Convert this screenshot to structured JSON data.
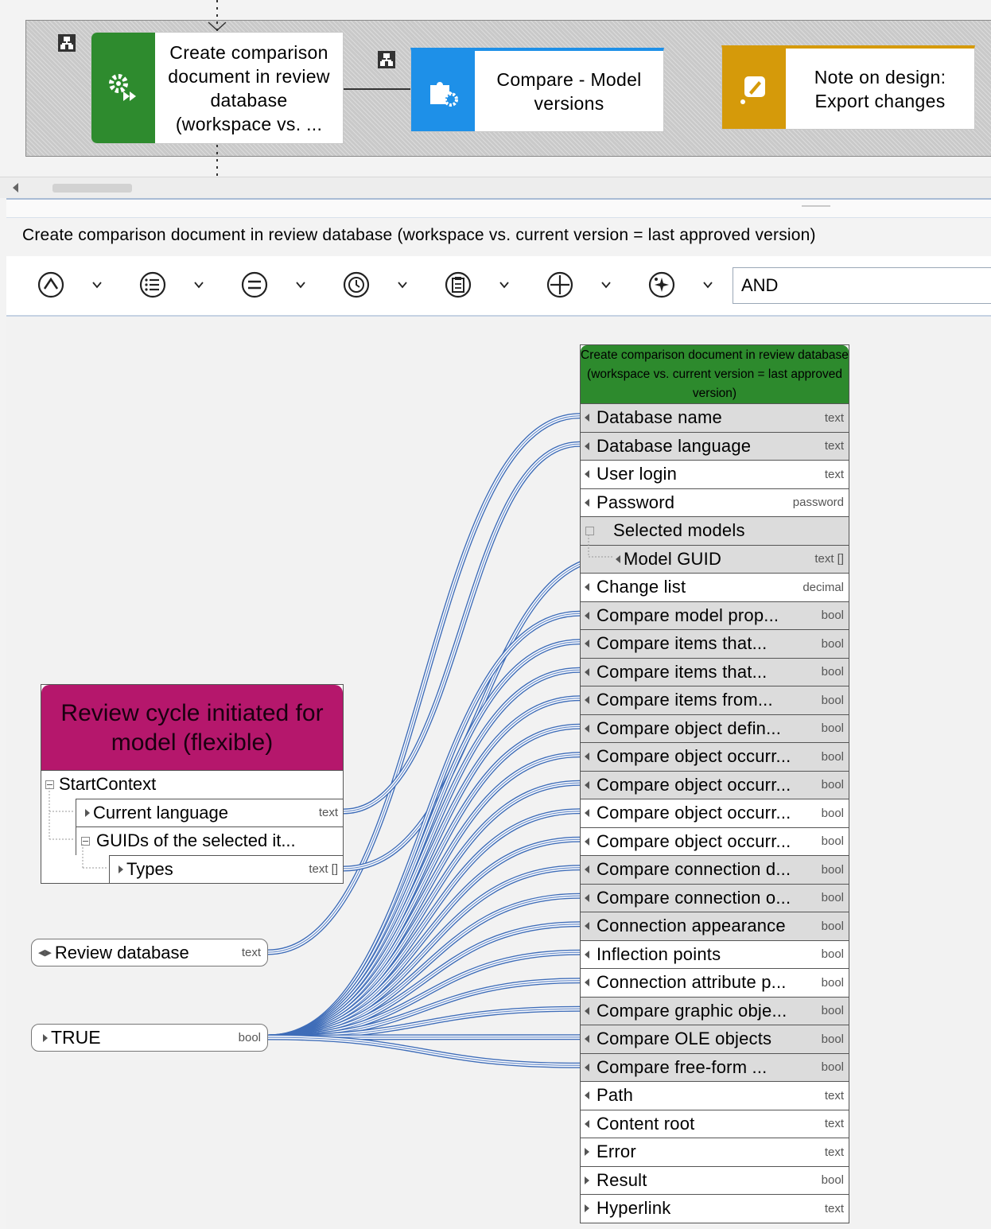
{
  "top_model": {
    "cards": [
      {
        "text": "Create comparison document in review database (workspace vs. ...",
        "icon": "gear-forward-icon",
        "color": "#2e8b2e"
      },
      {
        "text": "Compare - Model versions",
        "icon": "puzzle-gear-icon",
        "color": "#1e90e8"
      },
      {
        "text": "Note on design: Export changes",
        "icon": "edit-note-icon",
        "color": "#d59a0a"
      }
    ]
  },
  "details": {
    "title": "Create comparison document in review database (workspace vs. current version = last approved version)"
  },
  "toolbar": {
    "icons": [
      "circle-up-icon",
      "circle-list-icon",
      "circle-equals-icon",
      "circle-clock-icon",
      "circle-clipboard-icon",
      "circle-plus-icon",
      "circle-sparkle-icon"
    ],
    "operator": "AND"
  },
  "target": {
    "title": "Create comparison document in review database (workspace vs. current version = last approved version)",
    "rows": [
      {
        "label": "Database name",
        "type": "text",
        "gray": true
      },
      {
        "label": "Database language",
        "type": "text",
        "gray": true
      },
      {
        "label": "User login",
        "type": "text",
        "gray": false
      },
      {
        "label": "Password",
        "type": "password",
        "gray": false
      },
      {
        "label": "Selected models",
        "type": "",
        "gray": true
      },
      {
        "label": "Model GUID",
        "type": "text []",
        "gray": true
      },
      {
        "label": "Change list",
        "type": "decimal",
        "gray": false
      },
      {
        "label": "Compare model prop...",
        "type": "bool",
        "gray": true
      },
      {
        "label": "Compare items that...",
        "type": "bool",
        "gray": true
      },
      {
        "label": "Compare items that...",
        "type": "bool",
        "gray": true
      },
      {
        "label": "Compare items from...",
        "type": "bool",
        "gray": true
      },
      {
        "label": "Compare object defin...",
        "type": "bool",
        "gray": true
      },
      {
        "label": "Compare object occurr...",
        "type": "bool",
        "gray": true
      },
      {
        "label": "Compare object occurr...",
        "type": "bool",
        "gray": true
      },
      {
        "label": "Compare object occurr...",
        "type": "bool",
        "gray": false
      },
      {
        "label": "Compare object occurr...",
        "type": "bool",
        "gray": false
      },
      {
        "label": "Compare connection d...",
        "type": "bool",
        "gray": true
      },
      {
        "label": "Compare connection o...",
        "type": "bool",
        "gray": true
      },
      {
        "label": "Connection appearance",
        "type": "bool",
        "gray": true
      },
      {
        "label": "Inflection points",
        "type": "bool",
        "gray": false
      },
      {
        "label": "Connection attribute p...",
        "type": "bool",
        "gray": false
      },
      {
        "label": "Compare graphic obje...",
        "type": "bool",
        "gray": true
      },
      {
        "label": "Compare OLE objects",
        "type": "bool",
        "gray": true
      },
      {
        "label": "Compare free-form ...",
        "type": "bool",
        "gray": true
      },
      {
        "label": "Path",
        "type": "text",
        "gray": false
      },
      {
        "label": "Content root",
        "type": "text",
        "gray": false
      },
      {
        "label": "Error",
        "type": "text",
        "gray": false
      },
      {
        "label": "Result",
        "type": "bool",
        "gray": false
      },
      {
        "label": "Hyperlink",
        "type": "text",
        "gray": false
      }
    ]
  },
  "event": {
    "title": "Review cycle initiated for model (flexible)",
    "rows": [
      {
        "label": "StartContext",
        "type": ""
      },
      {
        "label": "Current language",
        "type": "text"
      },
      {
        "label": "GUIDs of the selected it...",
        "type": ""
      },
      {
        "label": "Types",
        "type": "text []"
      }
    ]
  },
  "constants": [
    {
      "label": "Review database",
      "type": "text"
    },
    {
      "label": "TRUE",
      "type": "bool"
    }
  ]
}
